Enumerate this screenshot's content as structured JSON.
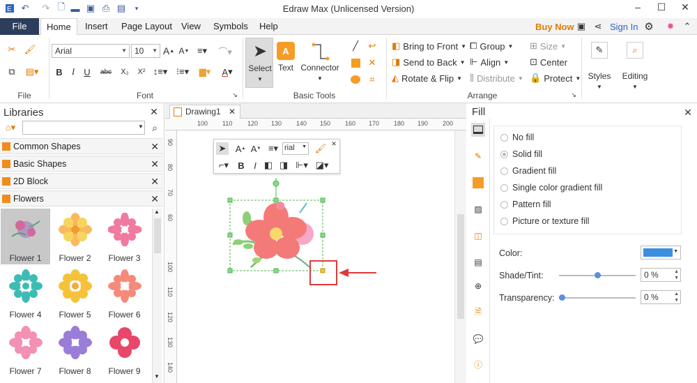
{
  "app": {
    "title": "Edraw Max (Unlicensed Version)"
  },
  "menu": {
    "tabs": [
      "File",
      "Home",
      "Insert",
      "Page Layout",
      "View",
      "Symbols",
      "Help"
    ],
    "buy_now": "Buy Now",
    "sign_in": "Sign In"
  },
  "ribbon": {
    "groups": {
      "file": "File",
      "font": "Font",
      "basic_tools": "Basic Tools",
      "arrange": "Arrange"
    },
    "font_name": "Arial",
    "font_size": "10",
    "tools": {
      "select": "Select",
      "text": "Text",
      "connector": "Connector"
    },
    "arrange": {
      "bring_to_front": "Bring to Front",
      "send_to_back": "Send to Back",
      "rotate_flip": "Rotate & Flip",
      "group": "Group",
      "align": "Align",
      "distribute": "Distribute",
      "size": "Size",
      "center": "Center",
      "protect": "Protect"
    },
    "styles": "Styles",
    "editing": "Editing"
  },
  "libraries": {
    "title": "Libraries",
    "search_placeholder": "",
    "categories": [
      "Common Shapes",
      "Basic Shapes",
      "2D Block",
      "Flowers"
    ],
    "shapes": [
      "Flower 1",
      "Flower 2",
      "Flower 3",
      "Flower 4",
      "Flower 5",
      "Flower 6",
      "Flower 7",
      "Flower 8",
      "Flower 9"
    ]
  },
  "document": {
    "tab": "Drawing1",
    "ruler_top": [
      "100",
      "110",
      "120",
      "130",
      "140",
      "150",
      "160",
      "170",
      "180",
      "190",
      "200"
    ],
    "ruler_left": [
      "90",
      "80",
      "70",
      "60",
      "100",
      "110",
      "120",
      "130",
      "140"
    ],
    "mini_toolbar_font": "rial"
  },
  "fill": {
    "title": "Fill",
    "options": [
      "No fill",
      "Solid fill",
      "Gradient fill",
      "Single color gradient fill",
      "Pattern fill",
      "Picture or texture fill"
    ],
    "selected": "Solid fill",
    "color_label": "Color:",
    "color_value": "#3b8fde",
    "shade_label": "Shade/Tint:",
    "shade_value": "0 %",
    "shade_level": 0.5,
    "transparency_label": "Transparency:",
    "transparency_value": "0 %",
    "transparency_level": 0.0
  }
}
